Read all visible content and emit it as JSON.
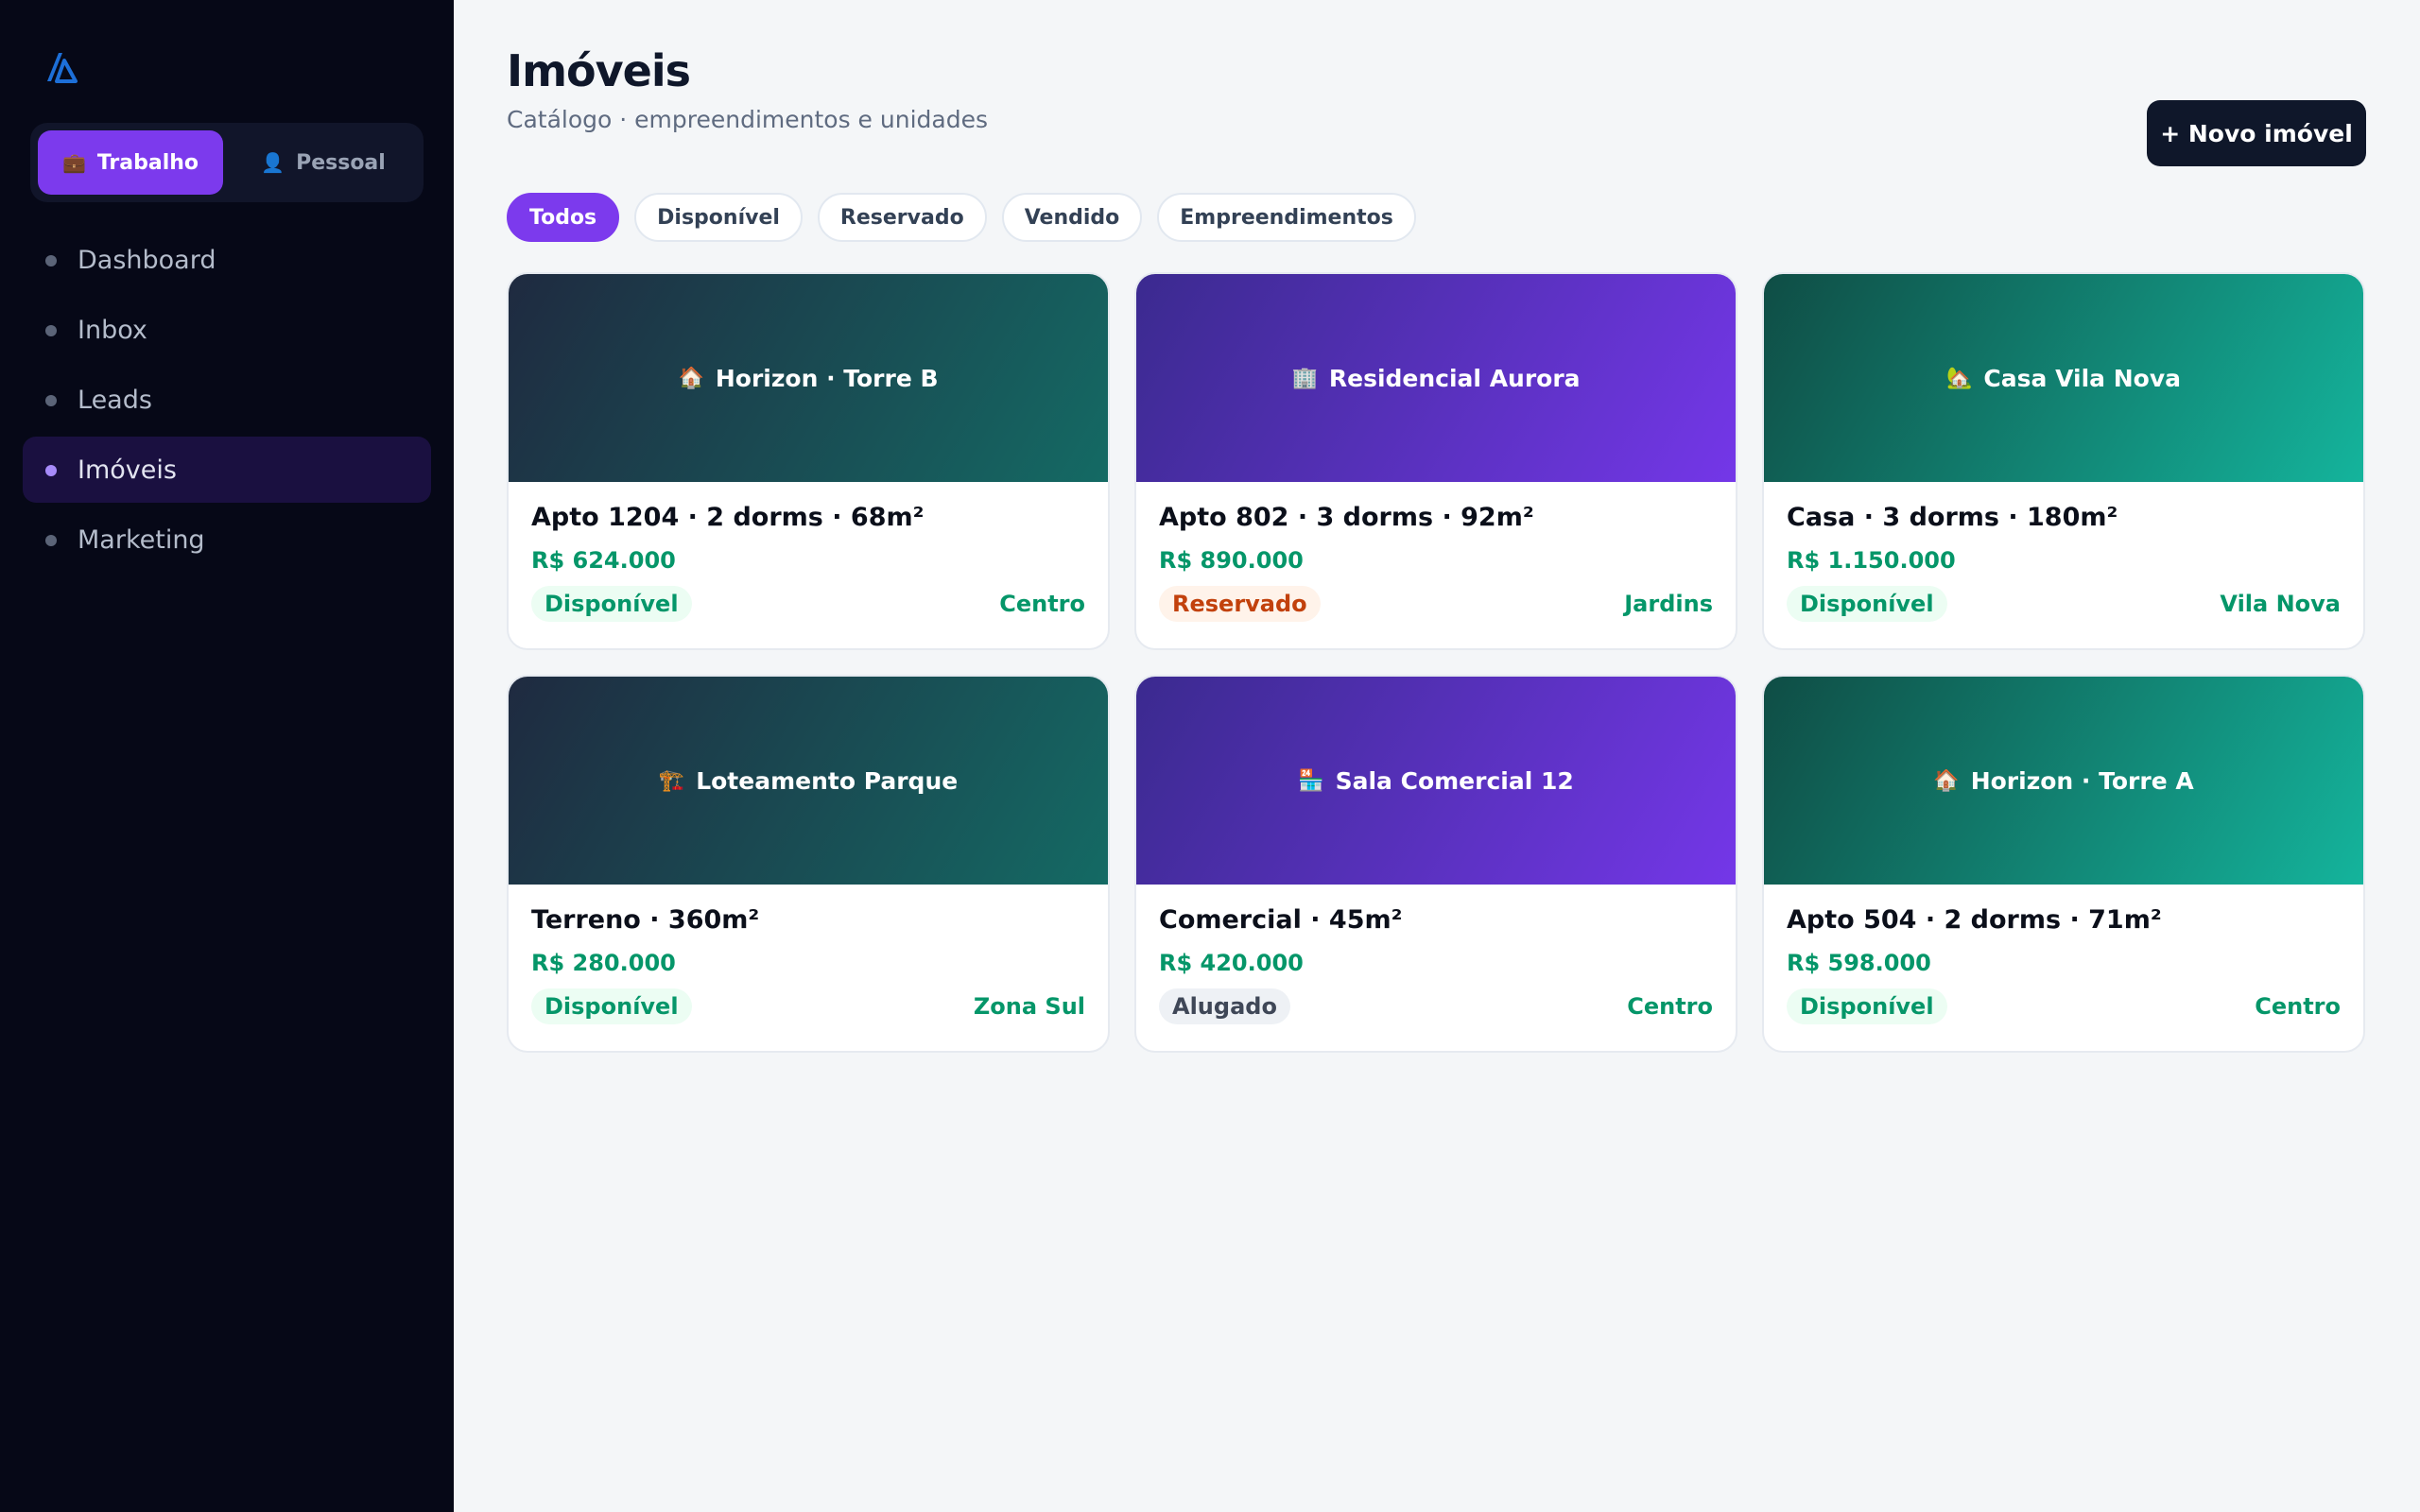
{
  "sidebar": {
    "context_switch": [
      {
        "label": "Trabalho",
        "icon": "briefcase-icon",
        "glyph": "💼",
        "active": true
      },
      {
        "label": "Pessoal",
        "icon": "user-icon",
        "glyph": "👤",
        "active": false
      }
    ],
    "nav": [
      {
        "label": "Dashboard",
        "active": false
      },
      {
        "label": "Inbox",
        "active": false
      },
      {
        "label": "Leads",
        "active": false
      },
      {
        "label": "Imóveis",
        "active": true
      },
      {
        "label": "Marketing",
        "active": false
      }
    ]
  },
  "header": {
    "title": "Imóveis",
    "subtitle": "Catálogo · empreendimentos e unidades",
    "new_button": "+ Novo imóvel"
  },
  "filters": [
    {
      "label": "Todos",
      "active": true
    },
    {
      "label": "Disponível",
      "active": false
    },
    {
      "label": "Reservado",
      "active": false
    },
    {
      "label": "Vendido",
      "active": false
    },
    {
      "label": "Empreendimentos",
      "active": false
    }
  ],
  "colors": {
    "accent": "#7c3aed",
    "sidebar_bg": "#060817",
    "price_green": "#059669",
    "reserved_orange": "#c2410c"
  },
  "cards": [
    {
      "hero_icon": "house-icon",
      "hero_glyph": "🏠",
      "hero_title": "Horizon · Torre B",
      "title": "Apto 1204 · 2 dorms · 68m²",
      "price": "R$ 624.000",
      "status": "Disponível",
      "location": "Centro",
      "theme": "slate"
    },
    {
      "hero_icon": "office-building-icon",
      "hero_glyph": "🏢",
      "hero_title": "Residencial Aurora",
      "title": "Apto 802 · 3 dorms · 92m²",
      "price": "R$ 890.000",
      "status": "Reservado",
      "location": "Jardins",
      "theme": "violet"
    },
    {
      "hero_icon": "house-garden-icon",
      "hero_glyph": "🏡",
      "hero_title": "Casa Vila Nova",
      "title": "Casa · 3 dorms · 180m²",
      "price": "R$ 1.150.000",
      "status": "Disponível",
      "location": "Vila Nova",
      "theme": "teal"
    },
    {
      "hero_icon": "construction-icon",
      "hero_glyph": "🏗️",
      "hero_title": "Loteamento Parque",
      "title": "Terreno · 360m²",
      "price": "R$ 280.000",
      "status": "Disponível",
      "location": "Zona Sul",
      "theme": "slate"
    },
    {
      "hero_icon": "shop-icon",
      "hero_glyph": "🏪",
      "hero_title": "Sala Comercial 12",
      "title": "Comercial · 45m²",
      "price": "R$ 420.000",
      "status": "Alugado",
      "location": "Centro",
      "theme": "violet"
    },
    {
      "hero_icon": "house-icon",
      "hero_glyph": "🏠",
      "hero_title": "Horizon · Torre A",
      "title": "Apto 504 · 2 dorms · 71m²",
      "price": "R$ 598.000",
      "status": "Disponível",
      "location": "Centro",
      "theme": "teal"
    }
  ]
}
